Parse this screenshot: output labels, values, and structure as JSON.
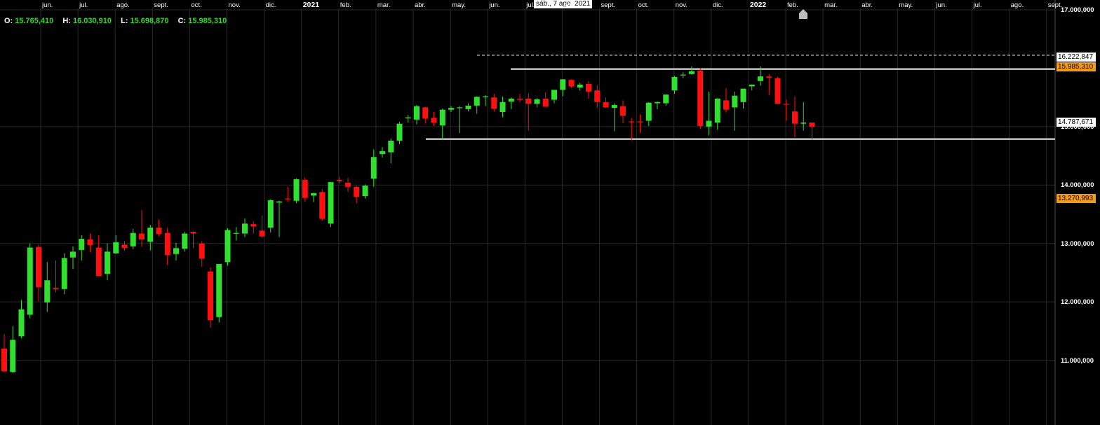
{
  "ohlc": {
    "o_label": "O:",
    "o_value": "15.765,410",
    "h_label": "H:",
    "h_value": "16.030,910",
    "l_label": "L:",
    "l_value": "15.698,870",
    "c_label": "C:",
    "c_value": "15.985,310"
  },
  "crosshair_date": "sáb., 7 ago. 2021",
  "price_tags": {
    "dashed": "16.222,847",
    "close": "15.985,310",
    "support": "14.787,671",
    "marker": "13.270,993"
  },
  "colors": {
    "up": "#2fe02f",
    "down": "#ff1010",
    "background": "#000000",
    "grid": "#2a2a2a",
    "marker": "#f49a1a"
  },
  "icons": {
    "home": "home-icon"
  },
  "chart_data": {
    "type": "candlestick",
    "timeframe": "weekly",
    "ylim": [
      10000,
      17000
    ],
    "y_ticks": [
      {
        "value": 11000,
        "label": "11.000,000"
      },
      {
        "value": 12000,
        "label": "12.000,000"
      },
      {
        "value": 13000,
        "label": "13.000,000"
      },
      {
        "value": 14000,
        "label": "14.000,000"
      },
      {
        "value": 15000,
        "label": "15.000,000"
      },
      {
        "value": 17000,
        "label": "17.000,000"
      }
    ],
    "x_ticks": [
      "jun.",
      "jul.",
      "ago.",
      "sept.",
      "oct.",
      "nov.",
      "dic.",
      "2021",
      "feb.",
      "mar.",
      "abr.",
      "may.",
      "jun.",
      "jul.",
      "ago.",
      "sept.",
      "oct.",
      "nov.",
      "dic.",
      "2022",
      "feb.",
      "mar.",
      "abr.",
      "may.",
      "jun.",
      "jul.",
      "ago.",
      "sept."
    ],
    "candles": [
      {
        "o": 11200,
        "h": 11450,
        "l": 10800,
        "c": 10810
      },
      {
        "o": 10800,
        "h": 11580,
        "l": 10780,
        "c": 11350
      },
      {
        "o": 11410,
        "h": 12030,
        "l": 11380,
        "c": 11870
      },
      {
        "o": 11780,
        "h": 13000,
        "l": 11720,
        "c": 12930
      },
      {
        "o": 12940,
        "h": 12980,
        "l": 12010,
        "c": 12250
      },
      {
        "o": 11990,
        "h": 12680,
        "l": 11830,
        "c": 12370
      },
      {
        "o": 12240,
        "h": 12710,
        "l": 12160,
        "c": 12220
      },
      {
        "o": 12220,
        "h": 12830,
        "l": 12130,
        "c": 12750
      },
      {
        "o": 12760,
        "h": 12950,
        "l": 12560,
        "c": 12860
      },
      {
        "o": 12890,
        "h": 13140,
        "l": 12710,
        "c": 13080
      },
      {
        "o": 13070,
        "h": 13170,
        "l": 12850,
        "c": 12970
      },
      {
        "o": 12930,
        "h": 13140,
        "l": 12460,
        "c": 12440
      },
      {
        "o": 12480,
        "h": 13000,
        "l": 12370,
        "c": 12860
      },
      {
        "o": 12830,
        "h": 13140,
        "l": 12820,
        "c": 13020
      },
      {
        "o": 12980,
        "h": 13040,
        "l": 12870,
        "c": 12920
      },
      {
        "o": 12950,
        "h": 13250,
        "l": 12900,
        "c": 13180
      },
      {
        "o": 13170,
        "h": 13570,
        "l": 12940,
        "c": 13070
      },
      {
        "o": 13030,
        "h": 13320,
        "l": 12880,
        "c": 13270
      },
      {
        "o": 13270,
        "h": 13410,
        "l": 13130,
        "c": 13160
      },
      {
        "o": 13180,
        "h": 13270,
        "l": 12630,
        "c": 12800
      },
      {
        "o": 12820,
        "h": 13010,
        "l": 12710,
        "c": 12920
      },
      {
        "o": 12910,
        "h": 13200,
        "l": 12860,
        "c": 13170
      },
      {
        "o": 13200,
        "h": 13210,
        "l": 12920,
        "c": 13170
      },
      {
        "o": 13000,
        "h": 13040,
        "l": 12600,
        "c": 12740
      },
      {
        "o": 12520,
        "h": 12590,
        "l": 11560,
        "c": 11690
      },
      {
        "o": 11740,
        "h": 12420,
        "l": 11650,
        "c": 12650
      },
      {
        "o": 12680,
        "h": 13260,
        "l": 12620,
        "c": 13230
      },
      {
        "o": 13170,
        "h": 13280,
        "l": 13050,
        "c": 13180
      },
      {
        "o": 13170,
        "h": 13430,
        "l": 13110,
        "c": 13340
      },
      {
        "o": 13330,
        "h": 13380,
        "l": 13170,
        "c": 13290
      },
      {
        "o": 13220,
        "h": 13480,
        "l": 13100,
        "c": 13120
      },
      {
        "o": 13270,
        "h": 13760,
        "l": 13190,
        "c": 13740
      },
      {
        "o": 13700,
        "h": 13730,
        "l": 13110,
        "c": 13720
      },
      {
        "o": 13770,
        "h": 13970,
        "l": 13710,
        "c": 13760
      },
      {
        "o": 13730,
        "h": 14110,
        "l": 13690,
        "c": 14100
      },
      {
        "o": 14090,
        "h": 14130,
        "l": 13720,
        "c": 13780
      },
      {
        "o": 13820,
        "h": 13870,
        "l": 13710,
        "c": 13860
      },
      {
        "o": 13880,
        "h": 13930,
        "l": 13390,
        "c": 13420
      },
      {
        "o": 13340,
        "h": 14050,
        "l": 13280,
        "c": 14050
      },
      {
        "o": 14090,
        "h": 14140,
        "l": 14030,
        "c": 14070
      },
      {
        "o": 14040,
        "h": 14120,
        "l": 13880,
        "c": 13970
      },
      {
        "o": 13970,
        "h": 13990,
        "l": 13690,
        "c": 13800
      },
      {
        "o": 13810,
        "h": 14010,
        "l": 13770,
        "c": 13990
      },
      {
        "o": 14110,
        "h": 14610,
        "l": 13970,
        "c": 14480
      },
      {
        "o": 14530,
        "h": 14650,
        "l": 14470,
        "c": 14580
      },
      {
        "o": 14560,
        "h": 14800,
        "l": 14370,
        "c": 14760
      },
      {
        "o": 14760,
        "h": 15080,
        "l": 14700,
        "c": 15050
      },
      {
        "o": 15150,
        "h": 15200,
        "l": 15070,
        "c": 15160
      },
      {
        "o": 15120,
        "h": 15370,
        "l": 15040,
        "c": 15350
      },
      {
        "o": 15330,
        "h": 15340,
        "l": 15050,
        "c": 15140
      },
      {
        "o": 15150,
        "h": 15250,
        "l": 15010,
        "c": 15070
      },
      {
        "o": 15020,
        "h": 15310,
        "l": 14770,
        "c": 15290
      },
      {
        "o": 15290,
        "h": 15350,
        "l": 15250,
        "c": 15320
      },
      {
        "o": 15320,
        "h": 15350,
        "l": 14890,
        "c": 15330
      },
      {
        "o": 15300,
        "h": 15400,
        "l": 15260,
        "c": 15360
      },
      {
        "o": 15360,
        "h": 15520,
        "l": 15220,
        "c": 15510
      },
      {
        "o": 15510,
        "h": 15540,
        "l": 15350,
        "c": 15520
      },
      {
        "o": 15500,
        "h": 15560,
        "l": 15260,
        "c": 15310
      },
      {
        "o": 15250,
        "h": 15510,
        "l": 15160,
        "c": 15420
      },
      {
        "o": 15430,
        "h": 15500,
        "l": 15300,
        "c": 15480
      },
      {
        "o": 15480,
        "h": 15560,
        "l": 15420,
        "c": 15460
      },
      {
        "o": 15480,
        "h": 15570,
        "l": 14930,
        "c": 15390
      },
      {
        "o": 15390,
        "h": 15490,
        "l": 15330,
        "c": 15470
      },
      {
        "o": 15480,
        "h": 15590,
        "l": 15340,
        "c": 15340
      },
      {
        "o": 15460,
        "h": 15630,
        "l": 15400,
        "c": 15630
      },
      {
        "o": 15630,
        "h": 15810,
        "l": 15520,
        "c": 15810
      },
      {
        "o": 15800,
        "h": 15810,
        "l": 15670,
        "c": 15690
      },
      {
        "o": 15670,
        "h": 15750,
        "l": 15620,
        "c": 15720
      },
      {
        "o": 15730,
        "h": 15780,
        "l": 15480,
        "c": 15600
      },
      {
        "o": 15620,
        "h": 15710,
        "l": 15320,
        "c": 15420
      },
      {
        "o": 15420,
        "h": 15500,
        "l": 15320,
        "c": 15330
      },
      {
        "o": 15320,
        "h": 15400,
        "l": 14920,
        "c": 15370
      },
      {
        "o": 15350,
        "h": 15450,
        "l": 15060,
        "c": 15190
      },
      {
        "o": 15090,
        "h": 15150,
        "l": 14760,
        "c": 15080
      },
      {
        "o": 15090,
        "h": 15210,
        "l": 14890,
        "c": 15080
      },
      {
        "o": 15100,
        "h": 15420,
        "l": 15010,
        "c": 15410
      },
      {
        "o": 15400,
        "h": 15430,
        "l": 15300,
        "c": 15420
      },
      {
        "o": 15400,
        "h": 15500,
        "l": 15360,
        "c": 15550
      },
      {
        "o": 15620,
        "h": 15870,
        "l": 15560,
        "c": 15850
      },
      {
        "o": 15880,
        "h": 15930,
        "l": 15830,
        "c": 15890
      },
      {
        "o": 15900,
        "h": 16030,
        "l": 15890,
        "c": 15950
      },
      {
        "o": 15960,
        "h": 16000,
        "l": 14960,
        "c": 15010
      },
      {
        "o": 15000,
        "h": 15600,
        "l": 14850,
        "c": 15100
      },
      {
        "o": 15070,
        "h": 15490,
        "l": 14950,
        "c": 15480
      },
      {
        "o": 15450,
        "h": 15660,
        "l": 15240,
        "c": 15290
      },
      {
        "o": 15330,
        "h": 15600,
        "l": 14930,
        "c": 15530
      },
      {
        "o": 15420,
        "h": 15600,
        "l": 15310,
        "c": 15650
      },
      {
        "o": 15690,
        "h": 15720,
        "l": 15620,
        "c": 15720
      },
      {
        "o": 15780,
        "h": 16030,
        "l": 15700,
        "c": 15860
      },
      {
        "o": 15860,
        "h": 15900,
        "l": 15540,
        "c": 15840
      },
      {
        "o": 15830,
        "h": 15850,
        "l": 15420,
        "c": 15390
      },
      {
        "o": 15390,
        "h": 15460,
        "l": 15100,
        "c": 15380
      },
      {
        "o": 15260,
        "h": 15520,
        "l": 14820,
        "c": 15050
      },
      {
        "o": 15050,
        "h": 15420,
        "l": 14930,
        "c": 15070
      },
      {
        "o": 15070,
        "h": 15070,
        "l": 14780,
        "c": 15000
      }
    ],
    "levels": [
      {
        "value": 16222.847,
        "style": "dashed"
      },
      {
        "value": 15985.31,
        "style": "solid"
      },
      {
        "value": 14787.671,
        "style": "solid"
      }
    ]
  }
}
